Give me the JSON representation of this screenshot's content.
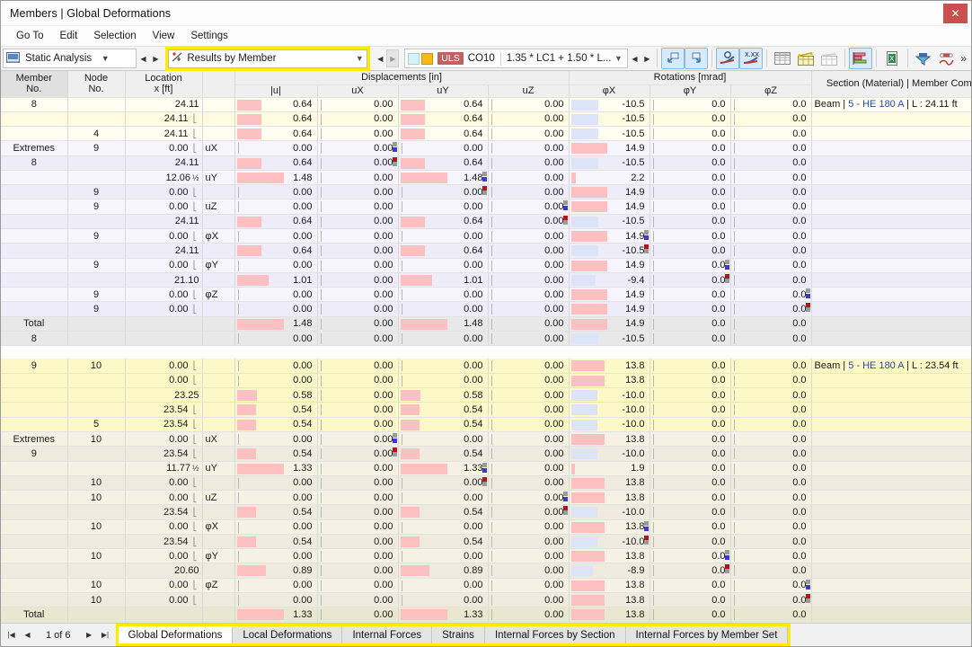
{
  "window": {
    "title": "Members | Global Deformations",
    "close_label": "✕"
  },
  "menu": {
    "items": [
      "Go To",
      "Edit",
      "Selection",
      "View",
      "Settings"
    ]
  },
  "toolbar": {
    "analysis_type": "Static Analysis",
    "result_view": "Results by Member",
    "load_case": "CO10",
    "load_case_kind": "ULS",
    "load_formula": "1.35 * LC1 + 1.50 * L...",
    "icons": [
      "undo-icon",
      "redo-icon",
      "find-value-icon",
      "xxx-value-icon",
      "table-grid-icon",
      "table-yellow-icon",
      "table-plain-icon",
      "chart-bar-icon",
      "excel-export-icon",
      "filter-icon",
      "settings-line-icon"
    ],
    "more_label": "»"
  },
  "table": {
    "group_headers": [
      {
        "label": "",
        "span": 4
      },
      {
        "label": "Displacements [in]",
        "span": 4
      },
      {
        "label": "Rotations [mrad]",
        "span": 3
      },
      {
        "label": "",
        "span": 1
      }
    ],
    "columns": [
      "Member\nNo.",
      "Node\nNo.",
      "Location\nx [ft]",
      "",
      "|u|",
      "uX",
      "uY",
      "uZ",
      "φX",
      "φY",
      "φZ",
      "Section (Material) | Member Comment"
    ],
    "col_headers_top": [
      "Member",
      "Node",
      "Location",
      "",
      "Displacements [in]",
      "Rotations [mrad]",
      "Section (Material) | Member Comment"
    ],
    "col_headers_bottom": [
      "No.",
      "No.",
      "x [ft]",
      "",
      "|u|",
      "uX",
      "uY",
      "uZ",
      "φX",
      "φY",
      "φZ",
      ""
    ],
    "blocks": [
      {
        "id": "member-8",
        "head_label": "8",
        "extremes_label": "Extremes",
        "extremes_sub": "8",
        "total_label": "Total",
        "total_sub": "8",
        "section": "Beam | 5 - HE 180 A | L : 24.11 ft",
        "rows": [
          {
            "tint": "t-cream",
            "node": "",
            "loc": "24.11",
            "locic": "",
            "comp": "",
            "u": "0.64",
            "ubar": 52,
            "ux": "0.00",
            "uy": "0.64",
            "uybar": 52,
            "uz": "0.00",
            "px": "-10.5",
            "pxbar": 58,
            "pxneg": true,
            "py": "0.0",
            "pz": "0.0",
            "section": "Beam | 5 - HE 180 A | L : 24.11 ft"
          },
          {
            "tint": "t-cream2",
            "node": "",
            "loc": "24.11",
            "locic": "sup",
            "comp": "",
            "u": "0.64",
            "ubar": 52,
            "ux": "0.00",
            "uy": "0.64",
            "uybar": 52,
            "uz": "0.00",
            "px": "-10.5",
            "pxbar": 58,
            "pxneg": true,
            "py": "0.0",
            "pz": "0.0",
            "section": ""
          },
          {
            "tint": "t-cream",
            "node": "4",
            "loc": "24.11",
            "locic": "sup",
            "comp": "",
            "u": "0.64",
            "ubar": 52,
            "ux": "0.00",
            "uy": "0.64",
            "uybar": 52,
            "uz": "0.00",
            "px": "-10.5",
            "pxbar": 58,
            "pxneg": true,
            "py": "0.0",
            "pz": "0.0",
            "section": ""
          },
          {
            "tint": "t-lav",
            "node": "9",
            "loc": "0.00",
            "locic": "sup",
            "comp": "uX",
            "u": "0.00",
            "ubar": 0,
            "ux": "0.00",
            "uxmk": "gb",
            "uy": "0.00",
            "uybar": 0,
            "uz": "0.00",
            "px": "14.9",
            "pxbar": 78,
            "py": "0.0",
            "pz": "0.0",
            "section": ""
          },
          {
            "tint": "t-lav2",
            "node": "",
            "loc": "24.11",
            "locic": "",
            "comp": "",
            "u": "0.64",
            "ubar": 52,
            "ux": "0.00",
            "uxmk": "rg",
            "uy": "0.64",
            "uybar": 52,
            "uz": "0.00",
            "px": "-10.5",
            "pxbar": 58,
            "pxneg": true,
            "py": "0.0",
            "pz": "0.0",
            "section": ""
          },
          {
            "tint": "t-lav",
            "node": "",
            "loc": "12.06",
            "locic": "half",
            "comp": "uY",
            "u": "1.48",
            "ubar": 100,
            "ux": "0.00",
            "uy": "1.48",
            "uybar": 100,
            "uymk": "gb",
            "uz": "0.00",
            "px": "2.2",
            "pxbar": 10,
            "py": "0.0",
            "pz": "0.0",
            "section": ""
          },
          {
            "tint": "t-lav2",
            "node": "9",
            "loc": "0.00",
            "locic": "sup",
            "comp": "",
            "u": "0.00",
            "ubar": 0,
            "ux": "0.00",
            "uy": "0.00",
            "uybar": 0,
            "uymk": "rg",
            "uz": "0.00",
            "px": "14.9",
            "pxbar": 78,
            "py": "0.0",
            "pz": "0.0",
            "section": ""
          },
          {
            "tint": "t-lav",
            "node": "9",
            "loc": "0.00",
            "locic": "sup",
            "comp": "uZ",
            "u": "0.00",
            "ubar": 0,
            "ux": "0.00",
            "uy": "0.00",
            "uybar": 0,
            "uz": "0.00",
            "uzmk": "gb",
            "px": "14.9",
            "pxbar": 78,
            "py": "0.0",
            "pz": "0.0",
            "section": ""
          },
          {
            "tint": "t-lav2",
            "node": "",
            "loc": "24.11",
            "locic": "",
            "comp": "",
            "u": "0.64",
            "ubar": 52,
            "ux": "0.00",
            "uy": "0.64",
            "uybar": 52,
            "uz": "0.00",
            "uzmk": "rg",
            "px": "-10.5",
            "pxbar": 58,
            "pxneg": true,
            "py": "0.0",
            "pz": "0.0",
            "section": ""
          },
          {
            "tint": "t-lav",
            "node": "9",
            "loc": "0.00",
            "locic": "sup",
            "comp": "φX",
            "u": "0.00",
            "ubar": 0,
            "ux": "0.00",
            "uy": "0.00",
            "uybar": 0,
            "uz": "0.00",
            "px": "14.9",
            "pxbar": 78,
            "pxmk": "gb",
            "py": "0.0",
            "pz": "0.0",
            "section": ""
          },
          {
            "tint": "t-lav2",
            "node": "",
            "loc": "24.11",
            "locic": "",
            "comp": "",
            "u": "0.64",
            "ubar": 52,
            "ux": "0.00",
            "uy": "0.64",
            "uybar": 52,
            "uz": "0.00",
            "px": "-10.5",
            "pxbar": 58,
            "pxneg": true,
            "pxmk": "rg",
            "py": "0.0",
            "pz": "0.0",
            "section": ""
          },
          {
            "tint": "t-lav",
            "node": "9",
            "loc": "0.00",
            "locic": "sup",
            "comp": "φY",
            "u": "0.00",
            "ubar": 0,
            "ux": "0.00",
            "uy": "0.00",
            "uybar": 0,
            "uz": "0.00",
            "px": "14.9",
            "pxbar": 78,
            "py": "0.0",
            "pymk": "gb",
            "pz": "0.0",
            "section": ""
          },
          {
            "tint": "t-lav2",
            "node": "",
            "loc": "21.10",
            "locic": "",
            "comp": "",
            "u": "1.01",
            "ubar": 68,
            "ux": "0.00",
            "uy": "1.01",
            "uybar": 68,
            "uz": "0.00",
            "px": "-9.4",
            "pxbar": 52,
            "pxneg": true,
            "py": "0.0",
            "pymk": "rg",
            "pz": "0.0",
            "section": ""
          },
          {
            "tint": "t-lav",
            "node": "9",
            "loc": "0.00",
            "locic": "sup",
            "comp": "φZ",
            "u": "0.00",
            "ubar": 0,
            "ux": "0.00",
            "uy": "0.00",
            "uybar": 0,
            "uz": "0.00",
            "px": "14.9",
            "pxbar": 78,
            "py": "0.0",
            "pz": "0.0",
            "pzmk": "gb",
            "section": ""
          },
          {
            "tint": "t-lav2",
            "node": "9",
            "loc": "0.00",
            "locic": "sup",
            "comp": "",
            "u": "0.00",
            "ubar": 0,
            "ux": "0.00",
            "uy": "0.00",
            "uybar": 0,
            "uz": "0.00",
            "px": "14.9",
            "pxbar": 78,
            "py": "0.0",
            "pz": "0.0",
            "pzmk": "rg",
            "section": ""
          },
          {
            "tint": "t-tot",
            "rowhead": "Total",
            "node": "",
            "loc": "",
            "comp": "",
            "u": "1.48",
            "ubar": 100,
            "ux": "0.00",
            "uy": "1.48",
            "uybar": 100,
            "uz": "0.00",
            "px": "14.9",
            "pxbar": 78,
            "py": "0.0",
            "pz": "0.0",
            "section": ""
          },
          {
            "tint": "t-tot",
            "rowhead": "8",
            "node": "",
            "loc": "",
            "comp": "",
            "u": "0.00",
            "ubar": 0,
            "ux": "0.00",
            "uy": "0.00",
            "uybar": 0,
            "uz": "0.00",
            "px": "-10.5",
            "pxbar": 58,
            "pxneg": true,
            "py": "0.0",
            "pz": "0.0",
            "section": ""
          }
        ]
      },
      {
        "id": "member-9",
        "head_label": "9",
        "extremes_label": "Extremes",
        "extremes_sub": "9",
        "total_label": "Total",
        "section": "Beam | 5 - HE 180 A | L : 23.54 ft",
        "rows": [
          {
            "tint": "t-yel",
            "node": "10",
            "loc": "0.00",
            "locic": "sup",
            "comp": "",
            "u": "0.00",
            "ubar": 0,
            "ux": "0.00",
            "uy": "0.00",
            "uybar": 0,
            "uz": "0.00",
            "px": "13.8",
            "pxbar": 72,
            "py": "0.0",
            "pz": "0.0",
            "section": "Beam | 5 - HE 180 A | L : 23.54 ft"
          },
          {
            "tint": "t-yel",
            "node": "",
            "loc": "0.00",
            "locic": "sup",
            "comp": "",
            "u": "0.00",
            "ubar": 0,
            "ux": "0.00",
            "uy": "0.00",
            "uybar": 0,
            "uz": "0.00",
            "px": "13.8",
            "pxbar": 72,
            "py": "0.0",
            "pz": "0.0",
            "section": ""
          },
          {
            "tint": "t-yel",
            "node": "",
            "loc": "23.25",
            "locic": "",
            "comp": "",
            "u": "0.58",
            "ubar": 44,
            "ux": "0.00",
            "uy": "0.58",
            "uybar": 44,
            "uz": "0.00",
            "px": "-10.0",
            "pxbar": 56,
            "pxneg": true,
            "py": "0.0",
            "pz": "0.0",
            "section": ""
          },
          {
            "tint": "t-yel",
            "node": "",
            "loc": "23.54",
            "locic": "sup",
            "comp": "",
            "u": "0.54",
            "ubar": 42,
            "ux": "0.00",
            "uy": "0.54",
            "uybar": 42,
            "uz": "0.00",
            "px": "-10.0",
            "pxbar": 56,
            "pxneg": true,
            "py": "0.0",
            "pz": "0.0",
            "section": ""
          },
          {
            "tint": "t-yel",
            "node": "5",
            "loc": "23.54",
            "locic": "sup",
            "comp": "",
            "u": "0.54",
            "ubar": 42,
            "ux": "0.00",
            "uy": "0.54",
            "uybar": 42,
            "uz": "0.00",
            "px": "-10.0",
            "pxbar": 56,
            "pxneg": true,
            "py": "0.0",
            "pz": "0.0",
            "section": ""
          },
          {
            "tint": "t-beige",
            "node": "10",
            "loc": "0.00",
            "locic": "sup",
            "comp": "uX",
            "u": "0.00",
            "ubar": 0,
            "ux": "0.00",
            "uxmk": "gb",
            "uy": "0.00",
            "uybar": 0,
            "uz": "0.00",
            "px": "13.8",
            "pxbar": 72,
            "py": "0.0",
            "pz": "0.0",
            "section": ""
          },
          {
            "tint": "t-beige2",
            "node": "",
            "loc": "23.54",
            "locic": "sup",
            "comp": "",
            "u": "0.54",
            "ubar": 42,
            "ux": "0.00",
            "uxmk": "rg",
            "uy": "0.54",
            "uybar": 42,
            "uz": "0.00",
            "px": "-10.0",
            "pxbar": 56,
            "pxneg": true,
            "py": "0.0",
            "pz": "0.0",
            "section": ""
          },
          {
            "tint": "t-beige",
            "node": "",
            "loc": "11.77",
            "locic": "half",
            "comp": "uY",
            "u": "1.33",
            "ubar": 100,
            "ux": "0.00",
            "uy": "1.33",
            "uybar": 100,
            "uymk": "gb",
            "uz": "0.00",
            "px": "1.9",
            "pxbar": 9,
            "py": "0.0",
            "pz": "0.0",
            "section": ""
          },
          {
            "tint": "t-beige2",
            "node": "10",
            "loc": "0.00",
            "locic": "sup",
            "comp": "",
            "u": "0.00",
            "ubar": 0,
            "ux": "0.00",
            "uy": "0.00",
            "uybar": 0,
            "uymk": "rg",
            "uz": "0.00",
            "px": "13.8",
            "pxbar": 72,
            "py": "0.0",
            "pz": "0.0",
            "section": ""
          },
          {
            "tint": "t-beige",
            "node": "10",
            "loc": "0.00",
            "locic": "sup",
            "comp": "uZ",
            "u": "0.00",
            "ubar": 0,
            "ux": "0.00",
            "uy": "0.00",
            "uybar": 0,
            "uz": "0.00",
            "uzmk": "gb",
            "px": "13.8",
            "pxbar": 72,
            "py": "0.0",
            "pz": "0.0",
            "section": ""
          },
          {
            "tint": "t-beige2",
            "node": "",
            "loc": "23.54",
            "locic": "sup",
            "comp": "",
            "u": "0.54",
            "ubar": 42,
            "ux": "0.00",
            "uy": "0.54",
            "uybar": 42,
            "uz": "0.00",
            "uzmk": "rg",
            "px": "-10.0",
            "pxbar": 56,
            "pxneg": true,
            "py": "0.0",
            "pz": "0.0",
            "section": ""
          },
          {
            "tint": "t-beige",
            "node": "10",
            "loc": "0.00",
            "locic": "sup",
            "comp": "φX",
            "u": "0.00",
            "ubar": 0,
            "ux": "0.00",
            "uy": "0.00",
            "uybar": 0,
            "uz": "0.00",
            "px": "13.8",
            "pxbar": 72,
            "pxmk": "gb",
            "py": "0.0",
            "pz": "0.0",
            "section": ""
          },
          {
            "tint": "t-beige2",
            "node": "",
            "loc": "23.54",
            "locic": "sup",
            "comp": "",
            "u": "0.54",
            "ubar": 42,
            "ux": "0.00",
            "uy": "0.54",
            "uybar": 42,
            "uz": "0.00",
            "px": "-10.0",
            "pxbar": 56,
            "pxneg": true,
            "pxmk": "rg",
            "py": "0.0",
            "pz": "0.0",
            "section": ""
          },
          {
            "tint": "t-beige",
            "node": "10",
            "loc": "0.00",
            "locic": "sup",
            "comp": "φY",
            "u": "0.00",
            "ubar": 0,
            "ux": "0.00",
            "uy": "0.00",
            "uybar": 0,
            "uz": "0.00",
            "px": "13.8",
            "pxbar": 72,
            "py": "0.0",
            "pymk": "gb",
            "pz": "0.0",
            "section": ""
          },
          {
            "tint": "t-beige2",
            "node": "",
            "loc": "20.60",
            "locic": "",
            "comp": "",
            "u": "0.89",
            "ubar": 62,
            "ux": "0.00",
            "uy": "0.89",
            "uybar": 62,
            "uz": "0.00",
            "px": "-8.9",
            "pxbar": 48,
            "pxneg": true,
            "py": "0.0",
            "pymk": "rg",
            "pz": "0.0",
            "section": ""
          },
          {
            "tint": "t-beige",
            "node": "10",
            "loc": "0.00",
            "locic": "sup",
            "comp": "φZ",
            "u": "0.00",
            "ubar": 0,
            "ux": "0.00",
            "uy": "0.00",
            "uybar": 0,
            "uz": "0.00",
            "px": "13.8",
            "pxbar": 72,
            "py": "0.0",
            "pz": "0.0",
            "pzmk": "gb",
            "section": ""
          },
          {
            "tint": "t-beige2",
            "node": "10",
            "loc": "0.00",
            "locic": "sup",
            "comp": "",
            "u": "0.00",
            "ubar": 0,
            "ux": "0.00",
            "uy": "0.00",
            "uybar": 0,
            "uz": "0.00",
            "px": "13.8",
            "pxbar": 72,
            "py": "0.0",
            "pz": "0.0",
            "pzmk": "rg",
            "section": ""
          },
          {
            "tint": "t-tot2",
            "rowhead": "Total",
            "node": "",
            "loc": "",
            "comp": "",
            "u": "1.33",
            "ubar": 100,
            "ux": "0.00",
            "uy": "1.33",
            "uybar": 100,
            "uz": "0.00",
            "px": "13.8",
            "pxbar": 72,
            "py": "0.0",
            "pz": "0.0",
            "section": ""
          }
        ]
      }
    ]
  },
  "bottom": {
    "page_info": "1 of 6",
    "first_label": "|◀",
    "prev_label": "◀",
    "next_label": "▶",
    "last_label": "▶|",
    "tabs": [
      {
        "label": "Global Deformations",
        "selected": true
      },
      {
        "label": "Local Deformations",
        "selected": false
      },
      {
        "label": "Internal Forces",
        "selected": false
      },
      {
        "label": "Strains",
        "selected": false
      },
      {
        "label": "Internal Forces by Section",
        "selected": false
      },
      {
        "label": "Internal Forces by Member Set",
        "selected": false
      }
    ]
  },
  "colors": {
    "highlight": "#ffeb00",
    "positive_bar": "#fcc0c0",
    "negative_bar": "#dde4f8",
    "uls_badge": "#c06262",
    "close_button": "#c9504f"
  }
}
